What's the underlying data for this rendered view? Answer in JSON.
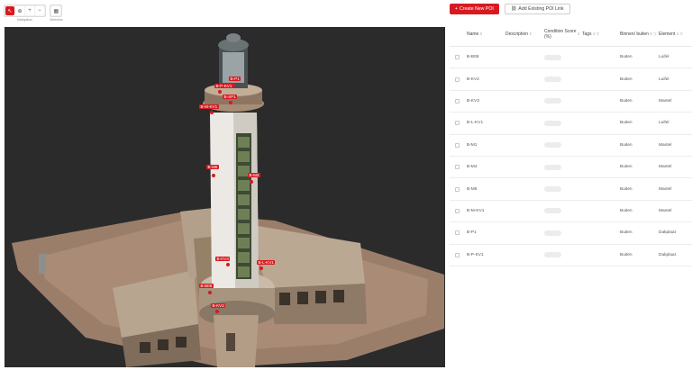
{
  "toolbar": {
    "groups": [
      {
        "caption": "Navigation",
        "buttons": [
          {
            "icon": "cursor-icon",
            "glyph": "↖",
            "active": true
          },
          {
            "icon": "zoom-fit-icon",
            "glyph": "⊕",
            "active": false
          },
          {
            "icon": "zoom-in-icon",
            "glyph": "+",
            "active": false
          },
          {
            "icon": "zoom-out-icon",
            "glyph": "−",
            "active": false
          }
        ]
      },
      {
        "caption": "Selection",
        "buttons": [
          {
            "icon": "layers-icon",
            "glyph": "▦",
            "active": false
          }
        ]
      }
    ]
  },
  "scene": {
    "poi_color": "#d71a21",
    "pois": [
      {
        "label": "B-P1"
      },
      {
        "label": "B-P-KV1"
      },
      {
        "label": "B-SP1"
      },
      {
        "label": "B-M-KV1"
      },
      {
        "label": "B-M6"
      },
      {
        "label": "B-M4"
      },
      {
        "label": "B-KV3"
      },
      {
        "label": "B-L-KV1"
      },
      {
        "label": "B-B08"
      },
      {
        "label": "B-KV2"
      }
    ]
  },
  "panel": {
    "create_label": "Create New POI",
    "create_icon": "plus-icon",
    "link_label": "Add Existing POI Link",
    "link_icon": "link-icon",
    "columns": {
      "name": "Name",
      "description": "Description",
      "score": "Condition Score (%)",
      "tags": "Tags",
      "binnen": "Binnen/ buiten",
      "element": "Element"
    },
    "rows": [
      {
        "name": "B-B08",
        "binnen": "Buiten",
        "element": "Luifel"
      },
      {
        "name": "B-KV2",
        "binnen": "Buiten",
        "element": "Luifel"
      },
      {
        "name": "B-KV3",
        "binnen": "Buiten",
        "element": "Mantel"
      },
      {
        "name": "B-L-KV1",
        "binnen": "Buiten",
        "element": "Luifel"
      },
      {
        "name": "B-M1",
        "binnen": "Buiten",
        "element": "Mantel"
      },
      {
        "name": "B-M4",
        "binnen": "Buiten",
        "element": "Mantel"
      },
      {
        "name": "B-M6",
        "binnen": "Buiten",
        "element": "Mantel"
      },
      {
        "name": "B-M-KV1",
        "binnen": "Buiten",
        "element": "Mantel"
      },
      {
        "name": "B-P1",
        "binnen": "Buiten",
        "element": "Dakplaat"
      },
      {
        "name": "B-P-KV1",
        "binnen": "Buiten",
        "element": "Dakplaat"
      }
    ]
  }
}
